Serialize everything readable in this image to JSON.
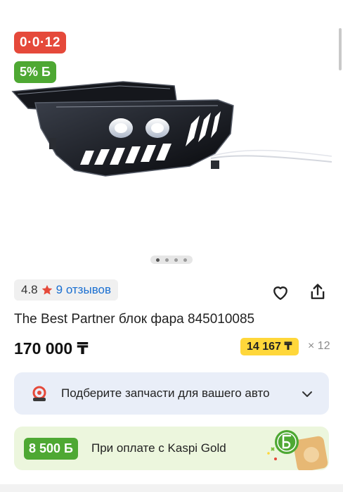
{
  "gallery": {
    "installment_badge": "0·0·12",
    "bonus_badge": "5% Б",
    "image_name": "led-headlight-photo",
    "carousel": {
      "total_dots": 4,
      "active_index": 0
    }
  },
  "rating": {
    "value": "4.8",
    "reviews_text": "9 отзывов",
    "star_color": "#e5493a"
  },
  "product": {
    "title": "The Best Partner блок фара 845010085",
    "price": "170 000 ₸",
    "monthly_payment": "14 167 ₸",
    "months": "× 12"
  },
  "parts_picker": {
    "label": "Подберите запчасти для вашего авто",
    "icon": "car-parts-icon",
    "chevron": "chevron-down-icon"
  },
  "kaspi_gold": {
    "bonus_amount": "8 500 Б",
    "label": "При оплате с Kaspi Gold",
    "art": "bonus-coin-illustration"
  },
  "colors": {
    "red": "#e5493a",
    "green": "#4ea833",
    "yellow": "#ffd73a",
    "link_blue": "#1a6fd1",
    "card_blue": "#e9eef8",
    "card_green": "#ecf6dd"
  }
}
